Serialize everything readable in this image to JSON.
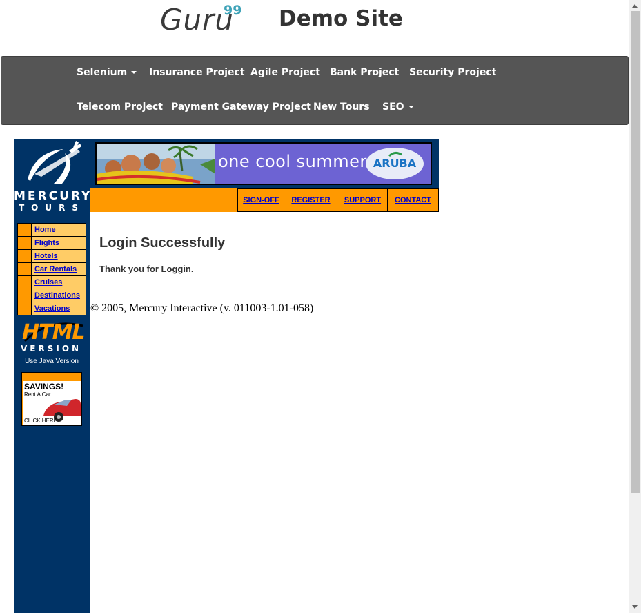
{
  "header": {
    "logo_text": "Guru",
    "logo_sup": "99",
    "site_title": "Demo Site"
  },
  "nav": {
    "row1": [
      {
        "label": "Selenium",
        "dropdown": true
      },
      {
        "label": "Insurance Project",
        "dropdown": false
      },
      {
        "label": "Agile Project",
        "dropdown": false
      },
      {
        "label": "Bank Project",
        "dropdown": false
      },
      {
        "label": "Security Project",
        "dropdown": false
      }
    ],
    "row2": [
      {
        "label": "Telecom Project",
        "dropdown": false
      },
      {
        "label": "Payment Gateway Project",
        "dropdown": false
      },
      {
        "label": "New Tours",
        "dropdown": false
      },
      {
        "label": "SEO",
        "dropdown": true
      }
    ]
  },
  "sidebar": {
    "brand_name": "MERCURY",
    "brand_sub": "TOURS",
    "menu": [
      "Home",
      "Flights",
      "Hotels",
      "Car Rentals",
      "Cruises",
      "Destinations",
      "Vacations"
    ],
    "badge_html": "HTML",
    "badge_version": "VERSION",
    "java_link": "Use Java Version",
    "ad_title": "SAVINGS!",
    "ad_sub": "Rent A Car",
    "ad_click": "CLICK HERE"
  },
  "banner": {
    "text": "one cool summer",
    "brand": "ARUBA"
  },
  "tabs": [
    "SIGN-OFF",
    "REGISTER",
    "SUPPORT",
    "CONTACT"
  ],
  "main": {
    "heading": "Login Successfully",
    "message": "Thank you for Loggin.",
    "footer": "© 2005, Mercury Interactive (v. 011003-1.01-058)"
  },
  "colors": {
    "navbar": "#555555",
    "sidebar": "#003366",
    "tabbar": "#ff9900",
    "menu_cell": "#ffcc66",
    "link": "#0000cc",
    "accent": "#3fa3b8"
  }
}
